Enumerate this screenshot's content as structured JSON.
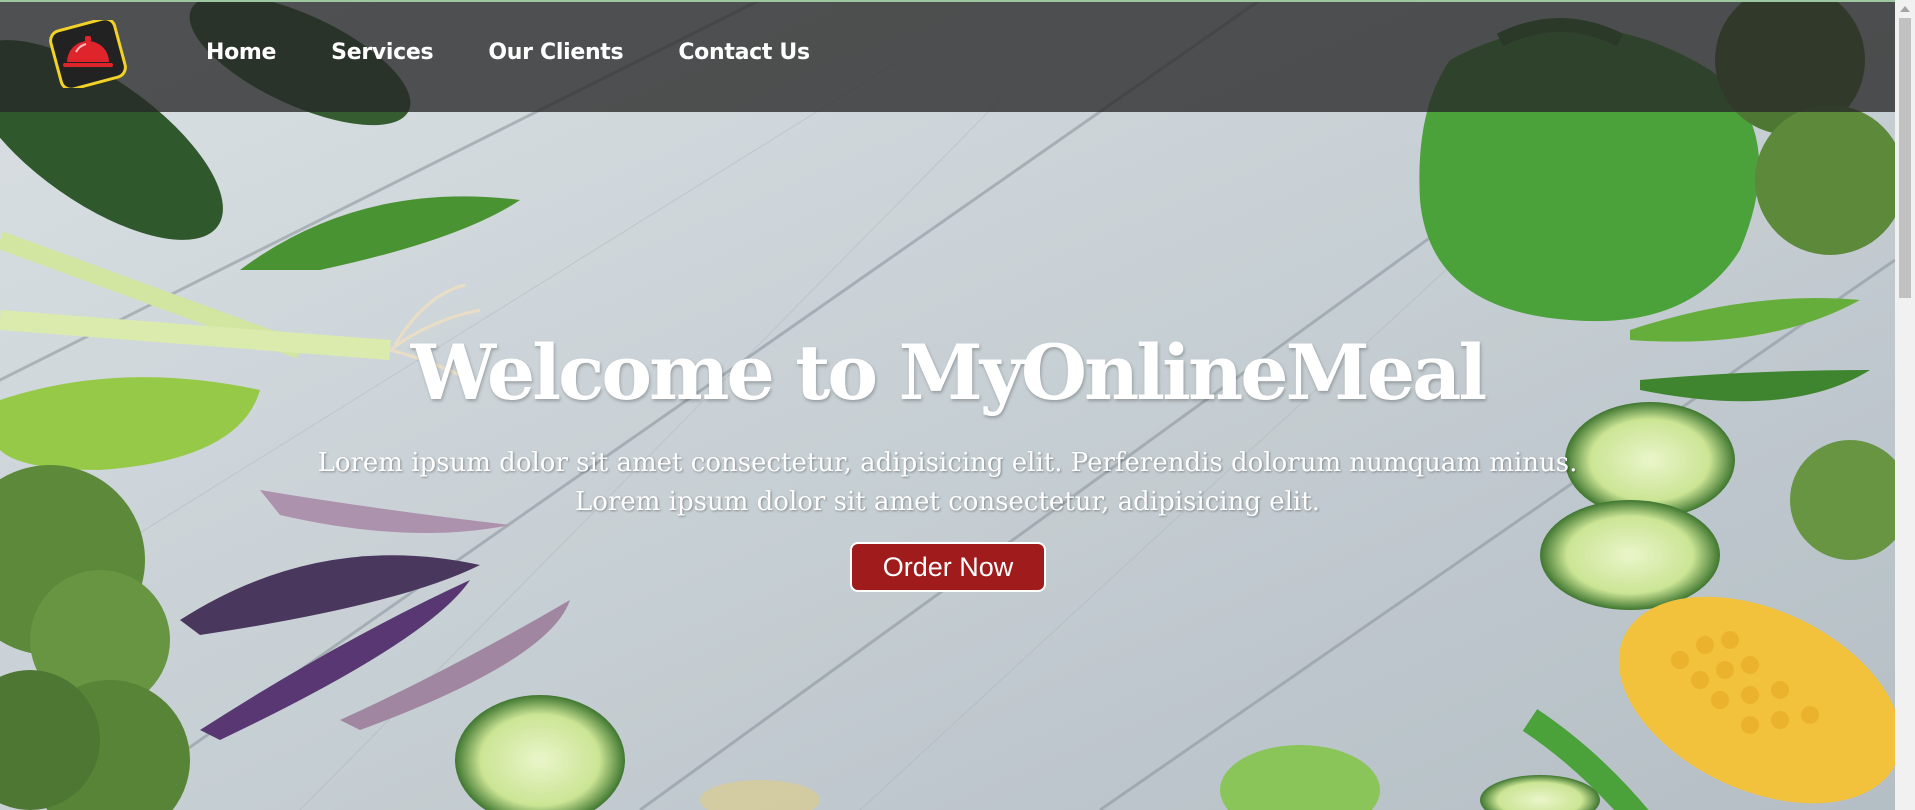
{
  "nav": {
    "links": [
      {
        "label": "Home"
      },
      {
        "label": "Services"
      },
      {
        "label": "Our Clients"
      },
      {
        "label": "Contact Us"
      }
    ]
  },
  "hero": {
    "title": "Welcome to MyOnlineMeal",
    "line1": "Lorem ipsum dolor sit amet consectetur, adipisicing elit. Perferendis dolorum numquam minus.",
    "line2": "Lorem ipsum dolor sit amet consectetur, adipisicing elit.",
    "cta_label": "Order Now"
  },
  "colors": {
    "nav_bg": "#282828",
    "cta_bg": "#a01c1c",
    "logo_border": "#f2d227",
    "logo_icon": "#e0242b"
  }
}
